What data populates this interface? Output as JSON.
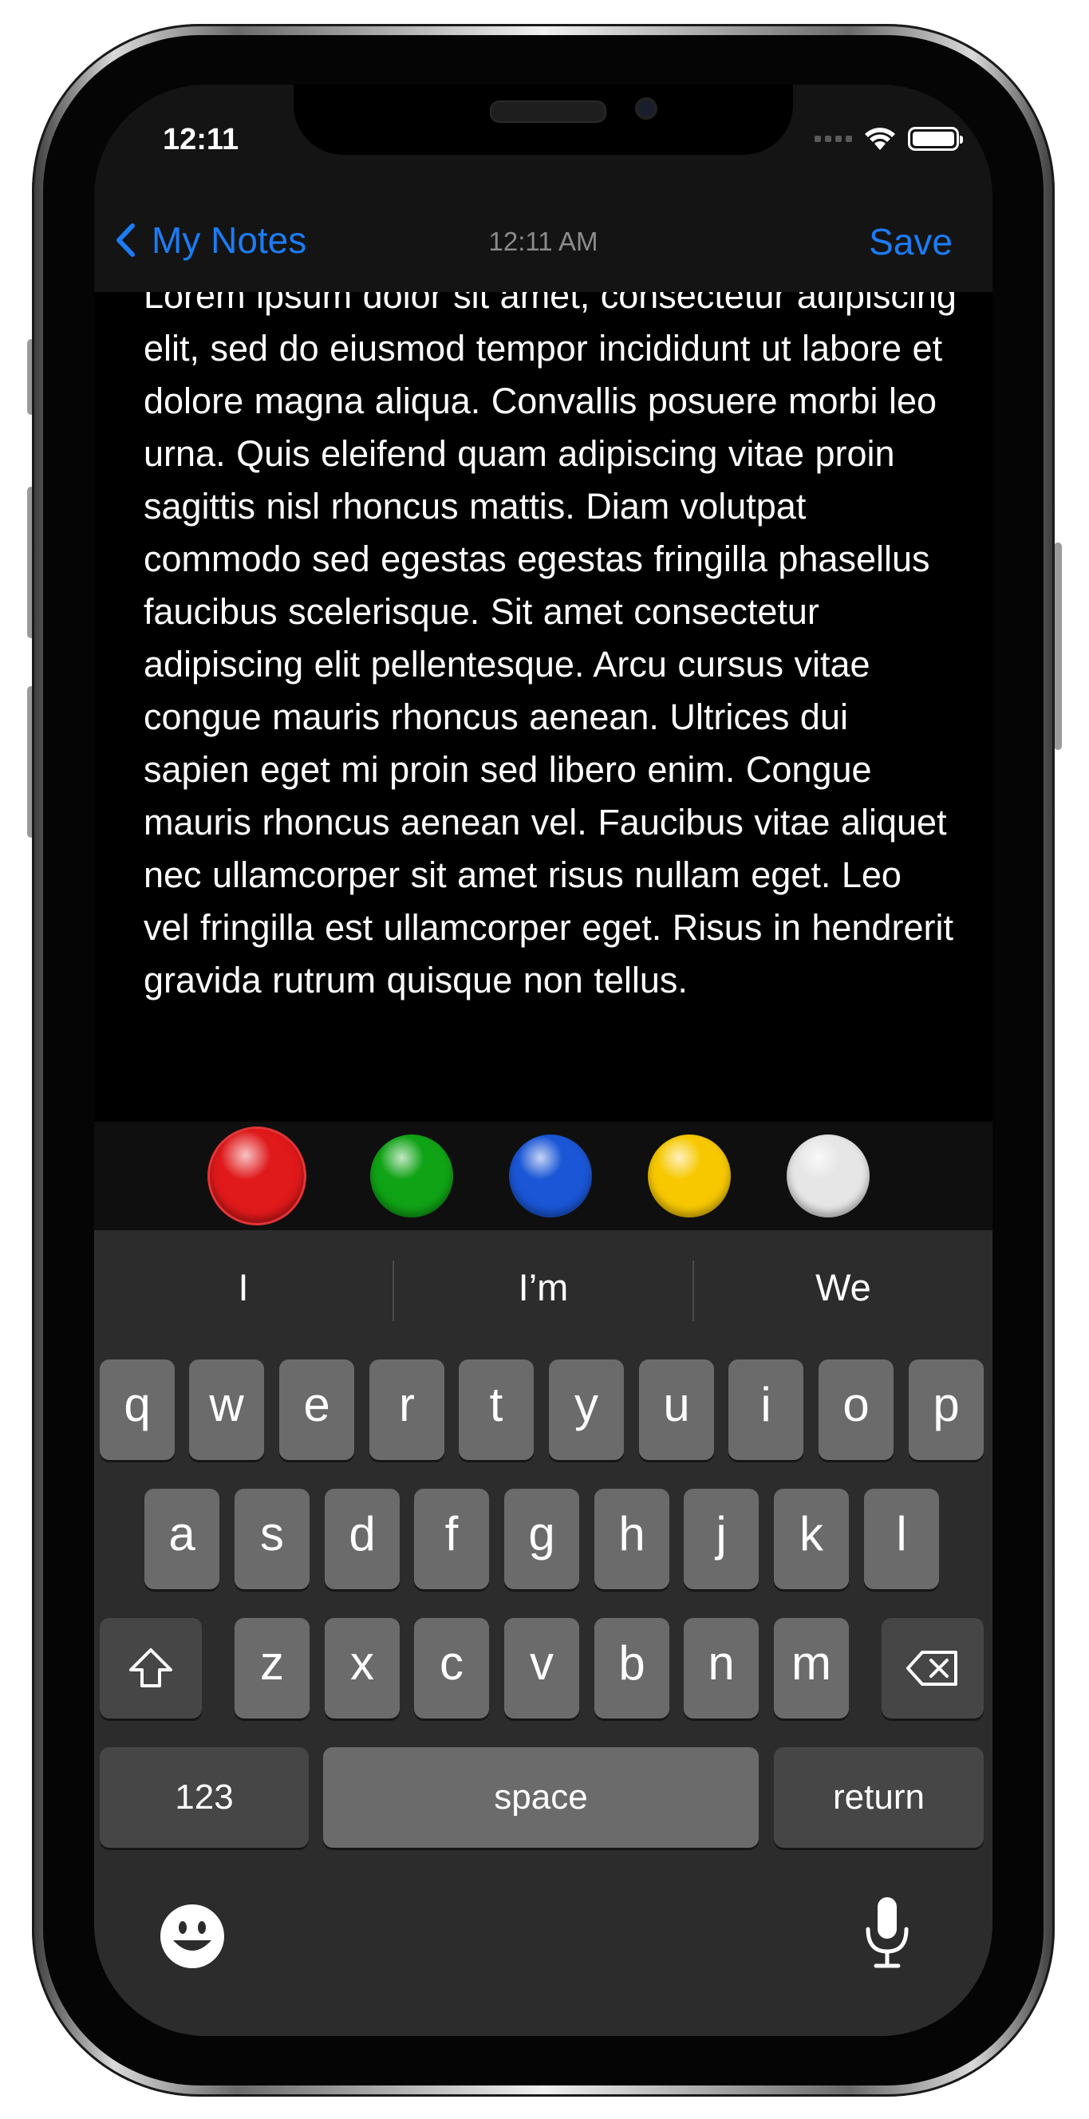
{
  "status_bar": {
    "time": "12:11",
    "battery_level": 1.0
  },
  "nav": {
    "back_label": "My Notes",
    "time": "12:11 AM",
    "save_label": "Save"
  },
  "note": {
    "body": "Lorem ipsum dolor sit amet, consectetur adipiscing elit, sed do eiusmod tempor incididunt ut labore et dolore magna aliqua. Convallis posuere morbi leo urna. Quis eleifend quam adipiscing vitae proin sagittis nisl rhoncus mattis. Diam volutpat commodo sed egestas egestas fringilla phasellus faucibus scelerisque. Sit amet consectetur adipiscing elit pellentesque. Arcu cursus vitae congue mauris rhoncus aenean. Ultrices dui sapien eget mi proin sed libero enim. Congue mauris rhoncus aenean vel. Faucibus vitae aliquet nec ullamcorper sit amet risus nullam eget. Leo vel fringilla est ullamcorper eget. Risus in hendrerit gravida rutrum quisque non tellus."
  },
  "colors": [
    {
      "name": "red",
      "hex": "#e0191b",
      "selected": true
    },
    {
      "name": "green",
      "hex": "#10a316"
    },
    {
      "name": "blue",
      "hex": "#1a56d6"
    },
    {
      "name": "yellow",
      "hex": "#f7c800"
    },
    {
      "name": "white",
      "hex": "#e6e6e6"
    }
  ],
  "keyboard": {
    "suggestions": [
      "I",
      "I’m",
      "We"
    ],
    "rows": [
      [
        "q",
        "w",
        "e",
        "r",
        "t",
        "y",
        "u",
        "i",
        "o",
        "p"
      ],
      [
        "a",
        "s",
        "d",
        "f",
        "g",
        "h",
        "j",
        "k",
        "l"
      ],
      [
        "z",
        "x",
        "c",
        "v",
        "b",
        "n",
        "m"
      ]
    ],
    "numbers_label": "123",
    "space_label": "space",
    "return_label": "return",
    "icons": {
      "shift": "shift-icon",
      "delete": "backspace-icon",
      "emoji": "emoji-icon",
      "dictation": "microphone-icon"
    }
  },
  "accent_color": "#1c7cf4"
}
